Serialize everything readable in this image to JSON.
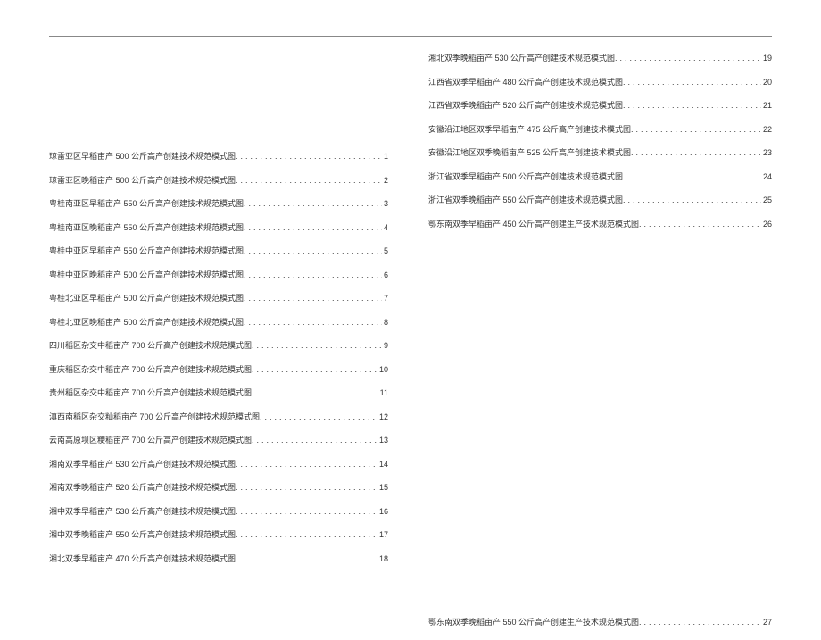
{
  "toc_left": [
    {
      "title": "琼雷亚区早稻亩产 500 公斤高产创建技术规范模式图",
      "page": "1"
    },
    {
      "title": "琼雷亚区晚稻亩产 500 公斤高产创建技术规范模式图",
      "page": "2"
    },
    {
      "title": "粤桂南亚区早稻亩产 550 公斤高产创建技术规范模式图",
      "page": "3"
    },
    {
      "title": "粤桂南亚区晚稻亩产 550 公斤高产创建技术规范模式图",
      "page": "4"
    },
    {
      "title": "粤桂中亚区早稻亩产 550 公斤高产创建技术规范模式图",
      "page": "5"
    },
    {
      "title": "粤桂中亚区晚稻亩产 500 公斤高产创建技术规范模式图",
      "page": "6"
    },
    {
      "title": "粤桂北亚区早稻亩产 500 公斤高产创建技术规范模式图",
      "page": "7"
    },
    {
      "title": "粤桂北亚区晚稻亩产 500 公斤高产创建技术规范模式图",
      "page": "8"
    },
    {
      "title": "四川稻区杂交中稻亩产 700 公斤高产创建技术规范模式图",
      "page": "9"
    },
    {
      "title": "重庆稻区杂交中稻亩产 700 公斤高产创建技术规范模式图",
      "page": "10"
    },
    {
      "title": "贵州稻区杂交中稻亩产 700 公斤高产创建技术规范模式图",
      "page": "11"
    },
    {
      "title": "滇西南稻区杂交籼稻亩产 700 公斤高产创建技术规范模式图",
      "page": "12"
    },
    {
      "title": "云南高原坝区粳稻亩产 700 公斤高产创建技术规范模式图",
      "page": "13"
    },
    {
      "title": "湘南双季早稻亩产 530 公斤高产创建技术规范模式图",
      "page": "14"
    },
    {
      "title": "湘南双季晚稻亩产 520 公斤高产创建技术规范模式图",
      "page": "15"
    },
    {
      "title": "湘中双季早稻亩产 530 公斤高产创建技术规范模式图",
      "page": "16"
    },
    {
      "title": "湘中双季晚稻亩产 550 公斤高产创建技术规范模式图",
      "page": "17"
    },
    {
      "title": "湘北双季早稻亩产 470 公斤高产创建技术规范模式图",
      "page": "18"
    }
  ],
  "toc_right_upper": [
    {
      "title": "湘北双季晚稻亩产 530 公斤高产创建技术规范模式图",
      "page": "19"
    },
    {
      "title": "江西省双季早稻亩产 480 公斤高产创建技术规范模式图",
      "page": "20"
    },
    {
      "title": "江西省双季晚稻亩产 520 公斤高产创建技术规范模式图",
      "page": "21"
    },
    {
      "title": "安徽沿江地区双季早稻亩产 475 公斤高产创建技术模式图",
      "page": "22"
    },
    {
      "title": "安徽沿江地区双季晚稻亩产 525 公斤高产创建技术模式图",
      "page": "23"
    },
    {
      "title": "浙江省双季早稻亩产 500 公斤高产创建技术规范模式图",
      "page": "24"
    },
    {
      "title": "浙江省双季晚稻亩产 550 公斤高产创建技术规范模式图",
      "page": "25"
    },
    {
      "title": "鄂东南双季早稻亩产 450 公斤高产创建生产技术规范模式图",
      "page": "26"
    }
  ],
  "toc_right_lower": [
    {
      "title": "鄂东南双季晚稻亩产 550 公斤高产创建生产技术规范模式图",
      "page": "27"
    }
  ]
}
